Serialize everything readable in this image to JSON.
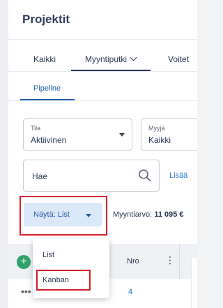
{
  "header": {
    "title": "Projektit"
  },
  "tabs": [
    {
      "label": "Kaikki"
    },
    {
      "label": "Myyntiputki"
    },
    {
      "label": "Voitet"
    }
  ],
  "subtabs": [
    {
      "label": "Pipeline"
    }
  ],
  "filters": {
    "tila": {
      "label": "Tila",
      "value": "Aktiivinen"
    },
    "myyja": {
      "label": "Myyjä",
      "value": "Kaikki"
    }
  },
  "search": {
    "placeholder": "Hae",
    "more_link": "Lisää"
  },
  "view": {
    "button_label": "Näytä: List",
    "sales_label": "Myyntiarvo:",
    "sales_value": "11 095 €"
  },
  "table": {
    "header": {
      "nro_label": "Nro"
    },
    "rows": [
      {
        "nro": "4"
      }
    ]
  },
  "dropdown": {
    "options": [
      "List",
      "Kanban"
    ]
  },
  "colors": {
    "accent": "#1f5fa8",
    "highlight_box": "#d32029",
    "add_button": "#2fa36b"
  }
}
